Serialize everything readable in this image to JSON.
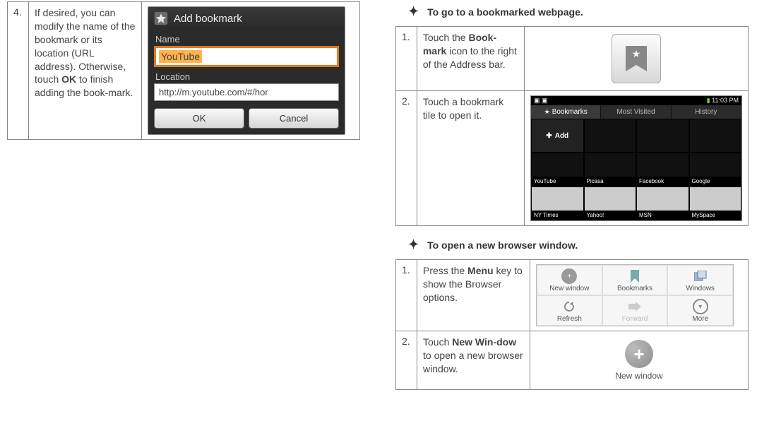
{
  "left": {
    "step4": {
      "num": "4.",
      "text_pre": "If desired, you can modify the name of the bookmark or its location (URL address). Otherwise, touch ",
      "bold": "OK",
      "text_post": " to finish adding the book-mark."
    },
    "dialog": {
      "title": "Add bookmark",
      "name_label": "Name",
      "name_value": "YouTube",
      "loc_label": "Location",
      "loc_value": "http://m.youtube.com/#/hor",
      "ok": "OK",
      "cancel": "Cancel"
    }
  },
  "right": {
    "head1": "To go to a bookmarked webpage.",
    "step1": {
      "num": "1.",
      "pre": "Touch the ",
      "bold": "Book-mark",
      "post": " icon to the right of the Address bar."
    },
    "step2": {
      "num": "2.",
      "text": "Touch a bookmark tile to open it."
    },
    "bm_screen": {
      "time": "11:03 PM",
      "tabs": {
        "a": "Bookmarks",
        "b": "Most Visited",
        "c": "History"
      },
      "add": "Add",
      "tiles_row1": [
        "YouTube",
        "Picasa",
        "Facebook",
        "Google"
      ],
      "tiles_row2": [
        "NY Times",
        "Yahoo!",
        "MSN",
        "MySpace"
      ]
    },
    "head2": "To open a new browser window.",
    "step3": {
      "num": "1.",
      "pre": "Press the ",
      "bold": "Menu",
      "post": " key to show the Browser options."
    },
    "opts": {
      "a": "New window",
      "b": "Bookmarks",
      "c": "Windows",
      "d": "Refresh",
      "e": "Forward",
      "f": "More"
    },
    "step4": {
      "num": "2.",
      "pre": "Touch ",
      "bold": "New Win-dow",
      "post": " to open a new browser window."
    },
    "nw_label": "New window"
  }
}
